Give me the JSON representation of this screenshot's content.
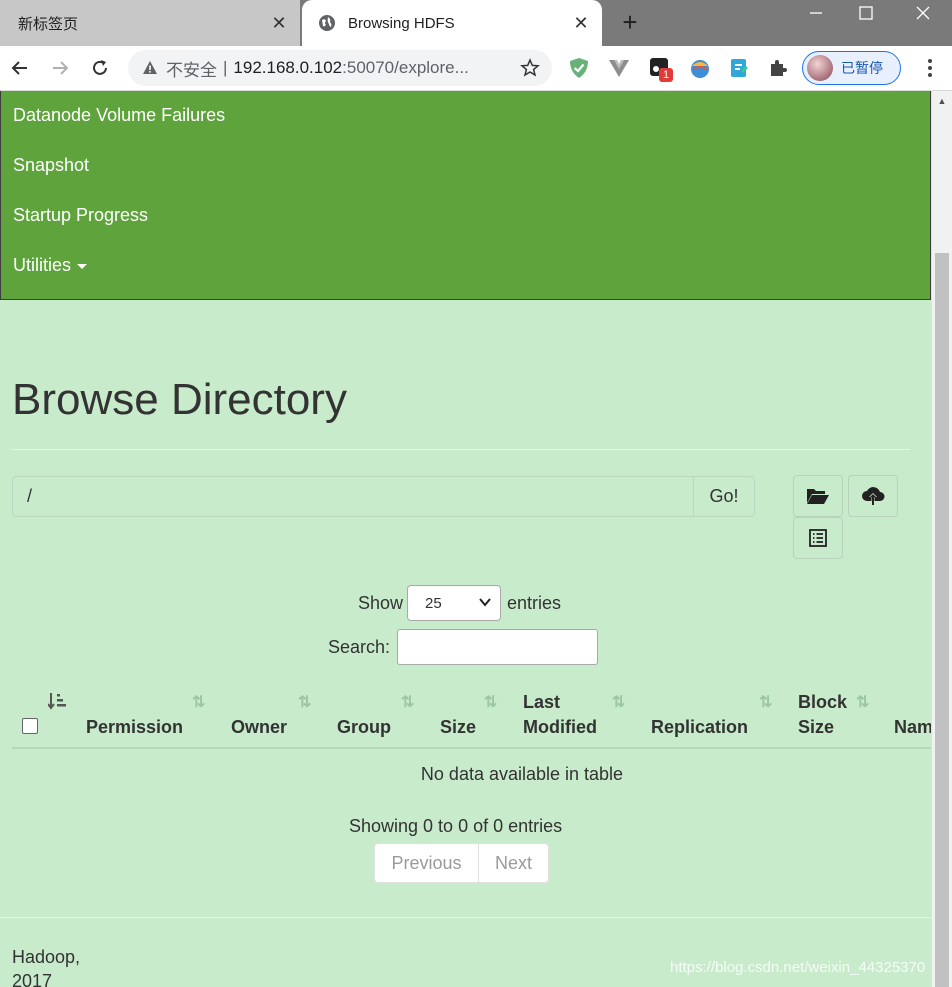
{
  "browser": {
    "tabs": [
      {
        "title": "新标签页",
        "active": false
      },
      {
        "title": "Browsing HDFS",
        "active": true
      }
    ],
    "new_tab": "+",
    "address": {
      "security_label": "不安全",
      "separator": "|",
      "host": "192.168.0.102",
      "rest": ":50070/explore..."
    },
    "profile": {
      "label": "已暂停"
    },
    "extension_badge": "1"
  },
  "nav": {
    "items": [
      {
        "label": "Datanode Volume Failures"
      },
      {
        "label": "Snapshot"
      },
      {
        "label": "Startup Progress"
      },
      {
        "label": "Utilities"
      }
    ],
    "bg_color": "#5fa33d"
  },
  "page": {
    "title": "Browse Directory",
    "path_value": "/",
    "go_label": "Go!"
  },
  "table": {
    "show_label": "Show",
    "page_size": "25",
    "entries_label": "entries",
    "search_label": "Search:",
    "columns": {
      "permission": "Permission",
      "owner": "Owner",
      "group": "Group",
      "size": "Size",
      "last_modified_1": "Last",
      "last_modified_2": "Modified",
      "replication": "Replication",
      "block_size_1": "Block",
      "block_size_2": "Size",
      "name": "Name"
    },
    "empty_message": "No data available in table",
    "info": "Showing 0 to 0 of 0 entries",
    "prev_label": "Previous",
    "next_label": "Next"
  },
  "footer": {
    "line1": "Hadoop,",
    "line2": "2017"
  },
  "watermark": "https://blog.csdn.net/weixin_44325370",
  "colors": {
    "page_bg": "#c8ebcc",
    "accent": "#1a73e8"
  }
}
